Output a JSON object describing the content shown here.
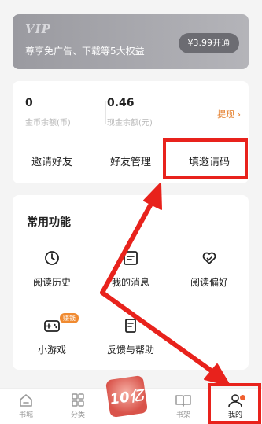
{
  "vip": {
    "title": "VIP",
    "description": "尊享免广告、下载等5大权益",
    "button": "¥3.99开通"
  },
  "balance": {
    "coins": {
      "value": "0",
      "label": "金币余额(币)"
    },
    "cash": {
      "value": "0.46",
      "label": "现金余额(元)"
    },
    "withdraw": "提现 ›"
  },
  "actions": [
    "邀请好友",
    "好友管理",
    "填邀请码"
  ],
  "functions": {
    "title": "常用功能",
    "items": [
      {
        "label": "阅读历史",
        "icon": "clock-icon"
      },
      {
        "label": "我的消息",
        "icon": "message-icon"
      },
      {
        "label": "阅读偏好",
        "icon": "heart-icon"
      },
      {
        "label": "小游戏",
        "icon": "gamepad-icon",
        "badge": "赚钱"
      },
      {
        "label": "反馈与帮助",
        "icon": "document-icon"
      }
    ]
  },
  "tabs": [
    {
      "label": "书城",
      "icon": "home-icon"
    },
    {
      "label": "分类",
      "icon": "grid-icon"
    },
    {
      "label": "10亿",
      "icon": "prize-badge-icon"
    },
    {
      "label": "书架",
      "icon": "book-icon"
    },
    {
      "label": "我的",
      "icon": "user-icon"
    }
  ],
  "colors": {
    "accent": "#e37a24",
    "annotation": "#e8221c"
  }
}
